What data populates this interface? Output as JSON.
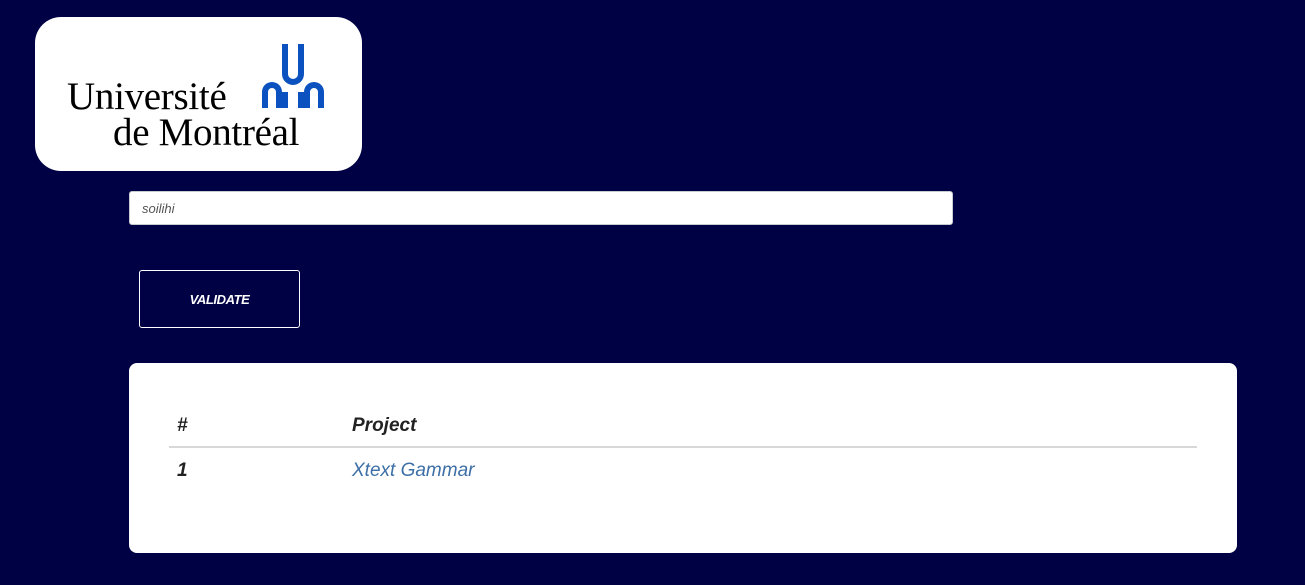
{
  "logo": {
    "line1": "Université",
    "line2": "de Montréal",
    "mark_color": "#0b52c0"
  },
  "search": {
    "value": "soilihi"
  },
  "validate": {
    "label": "VALIDATE"
  },
  "table": {
    "headers": [
      "#",
      "Project"
    ],
    "rows": [
      {
        "num": "1",
        "project": "Xtext Gammar"
      }
    ],
    "link_color": "#3d6fa6"
  },
  "colors": {
    "background": "#000045",
    "card": "#ffffff"
  }
}
